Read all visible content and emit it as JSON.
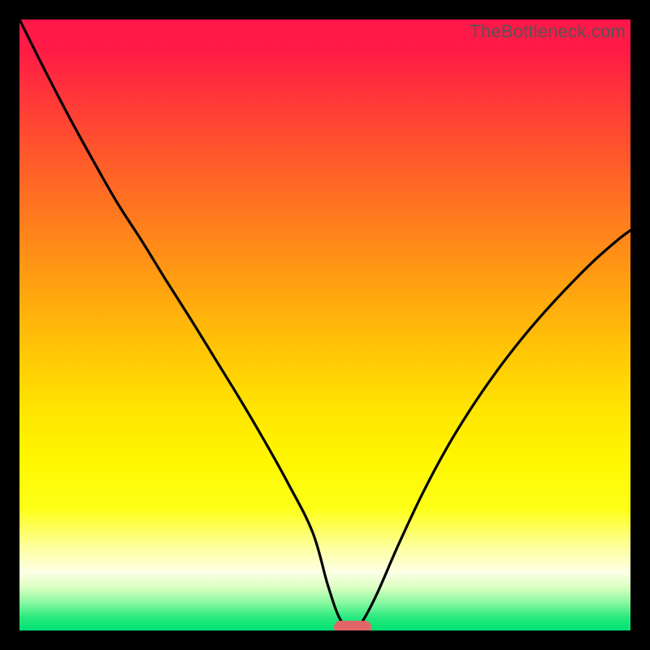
{
  "watermark": "TheBottleneck.com",
  "colors": {
    "background_black": "#000000",
    "gradient_stops": [
      {
        "offset": 0.0,
        "color": "#ff1749"
      },
      {
        "offset": 0.05,
        "color": "#ff1b46"
      },
      {
        "offset": 0.14,
        "color": "#ff3b37"
      },
      {
        "offset": 0.24,
        "color": "#ff5e29"
      },
      {
        "offset": 0.34,
        "color": "#ff801c"
      },
      {
        "offset": 0.44,
        "color": "#ffa310"
      },
      {
        "offset": 0.54,
        "color": "#ffc506"
      },
      {
        "offset": 0.64,
        "color": "#ffe501"
      },
      {
        "offset": 0.72,
        "color": "#fff700"
      },
      {
        "offset": 0.8,
        "color": "#feff17"
      },
      {
        "offset": 0.865,
        "color": "#fdffa0"
      },
      {
        "offset": 0.905,
        "color": "#fdffe6"
      },
      {
        "offset": 0.93,
        "color": "#d8ffc0"
      },
      {
        "offset": 0.955,
        "color": "#86f8a0"
      },
      {
        "offset": 0.978,
        "color": "#2be97e"
      },
      {
        "offset": 1.0,
        "color": "#00e174"
      }
    ],
    "curve_stroke": "#000000",
    "marker_fill": "#e06668"
  },
  "plot": {
    "inner_width": 752,
    "inner_height": 752,
    "border_px": 24
  },
  "chart_data": {
    "type": "line",
    "title": "",
    "xlabel": "",
    "ylabel": "",
    "xlim": [
      0,
      1
    ],
    "ylim": [
      0,
      1
    ],
    "x": [
      0.0,
      0.04,
      0.08,
      0.12,
      0.16,
      0.2,
      0.24,
      0.28,
      0.32,
      0.36,
      0.4,
      0.44,
      0.48,
      0.505,
      0.525,
      0.545,
      0.56,
      0.585,
      0.62,
      0.66,
      0.7,
      0.74,
      0.78,
      0.82,
      0.86,
      0.9,
      0.94,
      0.98,
      1.0
    ],
    "values": [
      1.0,
      0.92,
      0.843,
      0.77,
      0.7,
      0.638,
      0.573,
      0.51,
      0.445,
      0.38,
      0.312,
      0.24,
      0.16,
      0.073,
      0.018,
      0.0,
      0.013,
      0.06,
      0.14,
      0.225,
      0.3,
      0.365,
      0.423,
      0.475,
      0.522,
      0.565,
      0.605,
      0.64,
      0.655
    ],
    "minimum": {
      "x": 0.545,
      "y": 0.0
    },
    "legend": [],
    "grid": false
  }
}
